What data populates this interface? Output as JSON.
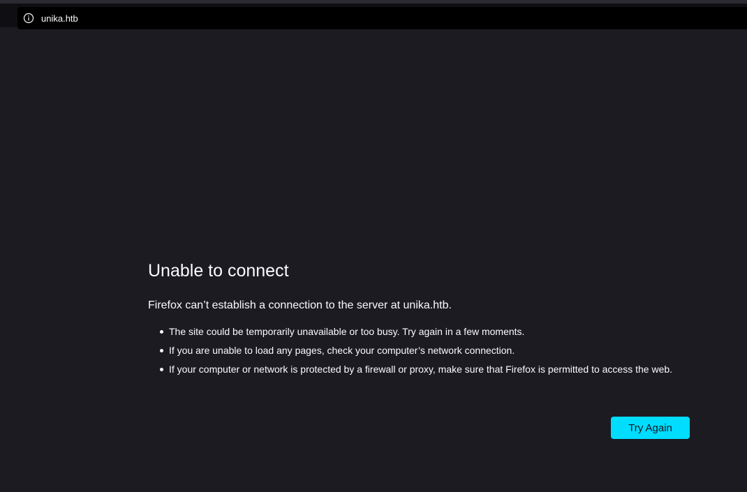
{
  "browser": {
    "url": "unika.htb",
    "icons": {
      "site_info": "info-circle-icon"
    }
  },
  "error_page": {
    "title": "Unable to connect",
    "intro": "Firefox can’t establish a connection to the server at unika.htb.",
    "suggestions": [
      "The site could be temporarily unavailable or too busy. Try again in a few moments.",
      "If you are unable to load any pages, check your computer’s network connection.",
      "If your computer or network is protected by a firewall or proxy, make sure that Firefox is permitted to access the web."
    ],
    "try_again_label": "Try Again"
  },
  "colors": {
    "background": "#1c1b22",
    "text": "#fbfbfe",
    "accent_button": "#00ddff",
    "urlbar": "#000000"
  }
}
